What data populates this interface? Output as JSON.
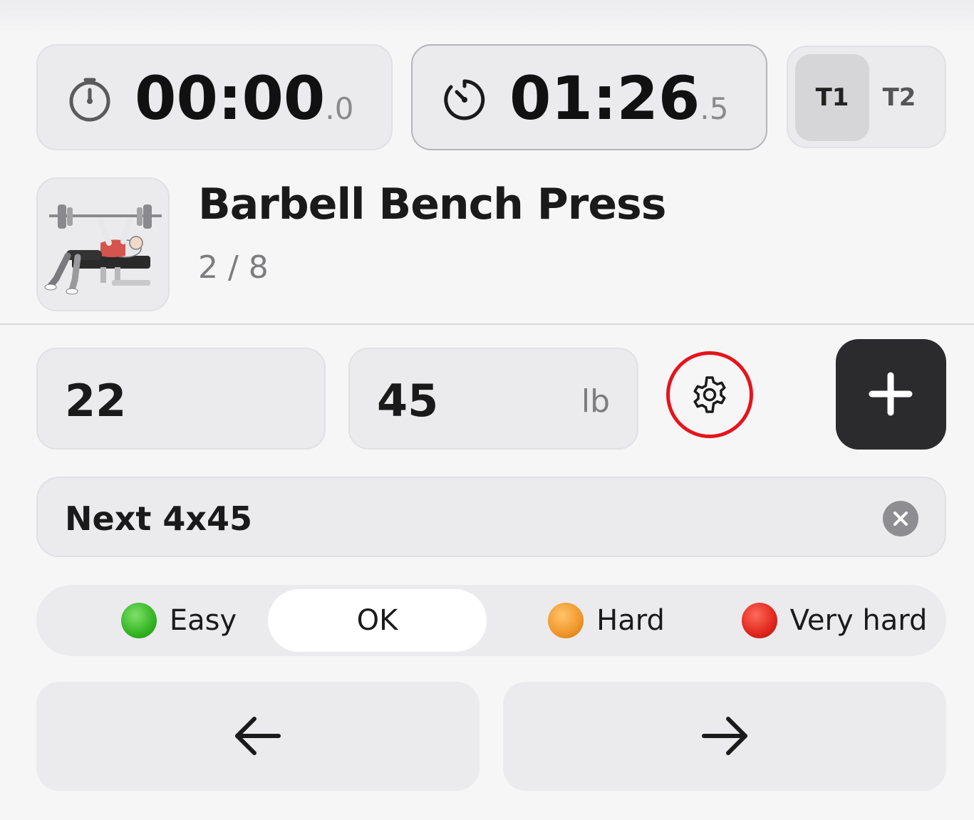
{
  "timers": {
    "stopwatch": {
      "main": "00:00",
      "fraction": ".0",
      "icon": "stopwatch-icon"
    },
    "rest": {
      "main": "01:26",
      "fraction": ".5",
      "icon": "rest-timer-icon"
    },
    "toggle": {
      "options": [
        "T1",
        "T2"
      ],
      "selected": "T1"
    }
  },
  "exercise": {
    "title": "Barbell Bench Press",
    "set_progress": "2 / 8",
    "thumbnail_icon": "bench-press-illustration"
  },
  "set_inputs": {
    "reps": "22",
    "weight": "45",
    "weight_unit": "lb",
    "settings_icon": "gear-icon",
    "add_icon": "plus-icon"
  },
  "note": {
    "text": "Next 4x45",
    "clear_icon": "clear-icon"
  },
  "difficulty": {
    "options": [
      {
        "label": "Easy",
        "color": "#34b424"
      },
      {
        "label": "OK",
        "color": ""
      },
      {
        "label": "Hard",
        "color": "#f0962a"
      },
      {
        "label": "Very hard",
        "color": "#e0261c"
      }
    ],
    "selected": "OK"
  },
  "navigation": {
    "prev_icon": "arrow-left-icon",
    "next_icon": "arrow-right-icon"
  },
  "colors": {
    "highlight_ring": "#e6141c",
    "add_button_bg": "#2b2b2d"
  }
}
